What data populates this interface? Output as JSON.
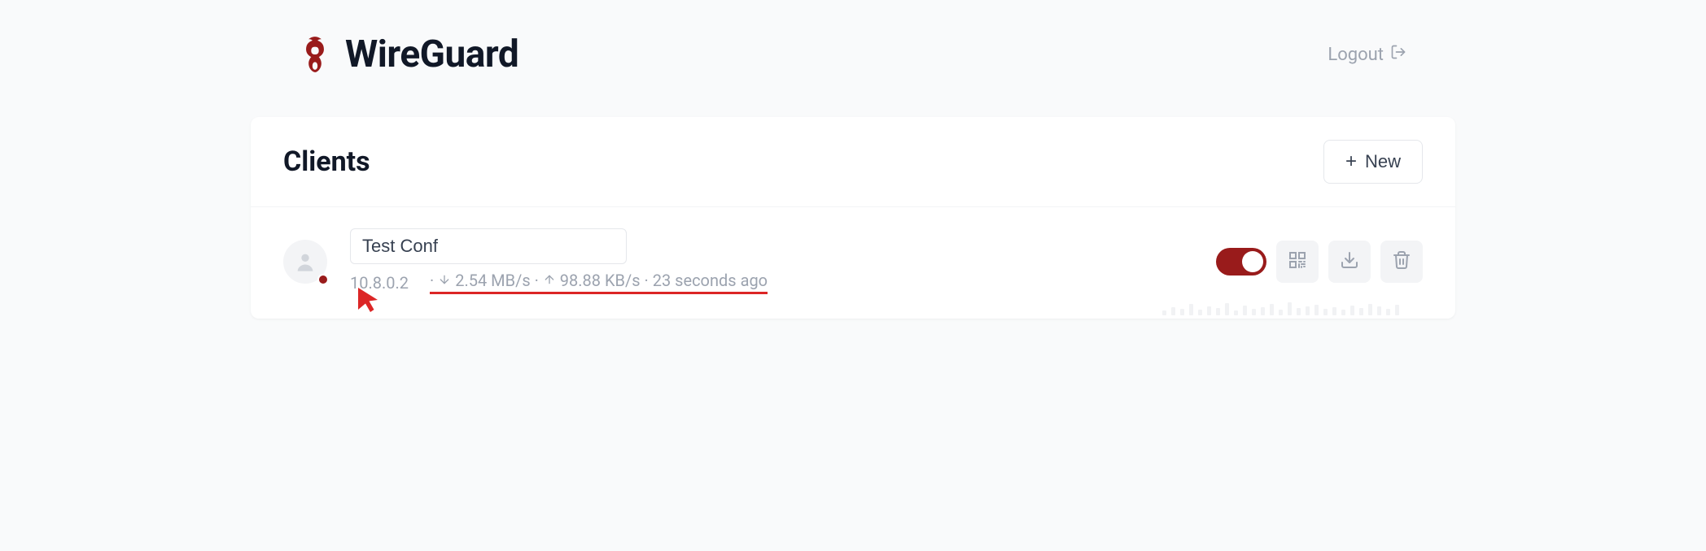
{
  "header": {
    "title": "WireGuard",
    "logout_label": "Logout"
  },
  "panel": {
    "title": "Clients",
    "new_button_label": "New"
  },
  "client": {
    "name": "Test Conf",
    "ip": "10.8.0.2",
    "download_rate": "2.54 MB/s",
    "upload_rate": "98.88 KB/s",
    "last_seen": "23 seconds ago",
    "toggle_on": true
  },
  "colors": {
    "accent": "#991b1b",
    "highlight": "#dc2626"
  }
}
